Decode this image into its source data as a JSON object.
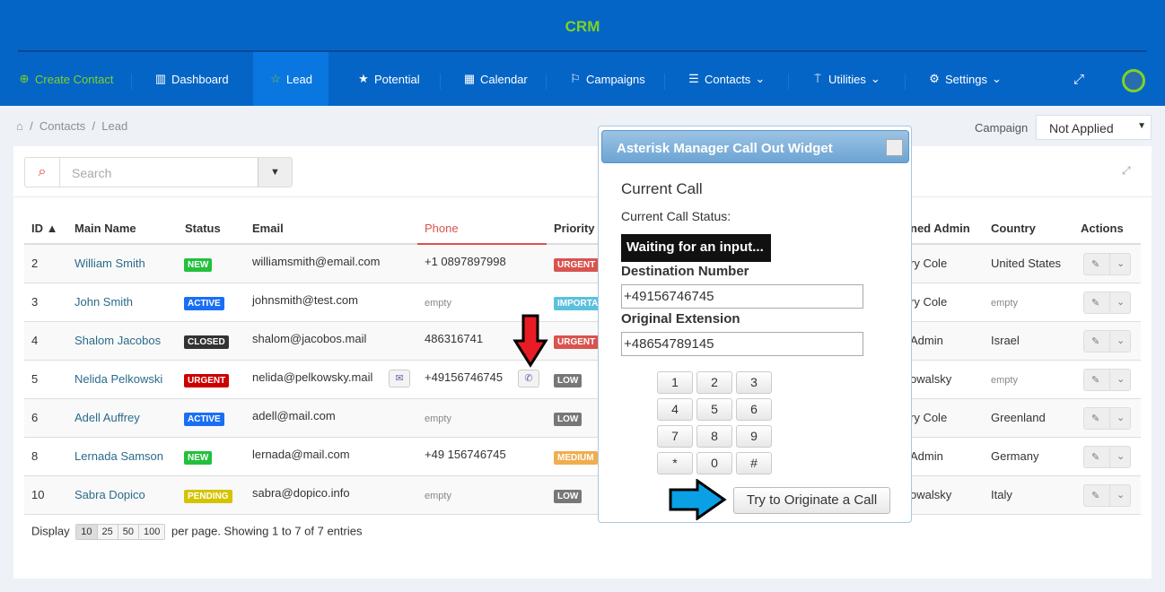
{
  "app": {
    "title": "CRM"
  },
  "nav": {
    "create_contact": "Create Contact",
    "items": [
      "Dashboard",
      "Lead",
      "Potential",
      "Calendar",
      "Campaigns",
      "Contacts",
      "Utilities",
      "Settings"
    ],
    "active": "Lead"
  },
  "breadcrumb": [
    "Contacts",
    "Lead"
  ],
  "campaign": {
    "label": "Campaign",
    "value": "Not Applied"
  },
  "search": {
    "placeholder": "Search"
  },
  "table": {
    "headers": {
      "id": "ID ▲",
      "name": "Main Name",
      "status": "Status",
      "email": "Email",
      "phone": "Phone",
      "priority": "Priority",
      "admin": "ned Admin",
      "country": "Country",
      "actions": "Actions"
    },
    "rows": [
      {
        "id": "2",
        "name": "William Smith",
        "status": "NEW",
        "email": "williamsmith@email.com",
        "phone": "+1 0897897998",
        "priority": "URGENT",
        "admin": "ry Cole",
        "country": "United States"
      },
      {
        "id": "3",
        "name": "John Smith",
        "status": "ACTIVE",
        "email": "johnsmith@test.com",
        "phone": "empty",
        "priority": "IMPORTA",
        "admin": "ry Cole",
        "country": "empty"
      },
      {
        "id": "4",
        "name": "Shalom Jacobos",
        "status": "CLOSED",
        "email": "shalom@jacobos.mail",
        "phone": "486316741",
        "priority": "URGENT",
        "admin": "Admin",
        "country": "Israel"
      },
      {
        "id": "5",
        "name": "Nelida Pelkowski",
        "status": "URGENT",
        "email": "nelida@pelkowsky.mail",
        "phone": "+49156746745",
        "priority": "LOW",
        "admin": "owalsky",
        "country": "empty"
      },
      {
        "id": "6",
        "name": "Adell Auffrey",
        "status": "ACTIVE",
        "email": "adell@mail.com",
        "phone": "empty",
        "priority": "LOW",
        "admin": "ry Cole",
        "country": "Greenland"
      },
      {
        "id": "8",
        "name": "Lernada Samson",
        "status": "NEW",
        "email": "lernada@mail.com",
        "phone": "+49 156746745",
        "priority": "MEDIUM",
        "admin": "Admin",
        "country": "Germany"
      },
      {
        "id": "10",
        "name": "Sabra Dopico",
        "status": "PENDING",
        "email": "sabra@dopico.info",
        "phone": "empty",
        "priority": "LOW",
        "admin": "owalsky",
        "country": "Italy"
      }
    ]
  },
  "footer": {
    "display": "Display",
    "sizes": [
      "10",
      "25",
      "50",
      "100"
    ],
    "selected": "10",
    "info": "per page. Showing 1 to 7 of 7 entries"
  },
  "widget": {
    "title": "Asterisk Manager Call Out Widget",
    "current_call": "Current Call",
    "status_label": "Current Call Status:",
    "status": "Waiting for an input...",
    "dest_label": "Destination Number",
    "dest_value": "+49156746745",
    "ext_label": "Original Extension",
    "ext_value": "+48654789145",
    "keys": [
      "1",
      "2",
      "3",
      "4",
      "5",
      "6",
      "7",
      "8",
      "9",
      "*",
      "0",
      "#"
    ],
    "originate": "Try to Originate a Call"
  },
  "colors": {
    "NEW": "#22c03c",
    "ACTIVE": "#1a6ef5",
    "CLOSED": "#333333",
    "URGENT": "#cc0000",
    "PENDING": "#d4c400",
    "p_URGENT": "#d9534f",
    "p_IMPORTA": "#5bc0de",
    "p_LOW": "#777777",
    "p_MEDIUM": "#f0ad4e",
    "nav": "#0565c6",
    "accent": "#7ed321"
  }
}
